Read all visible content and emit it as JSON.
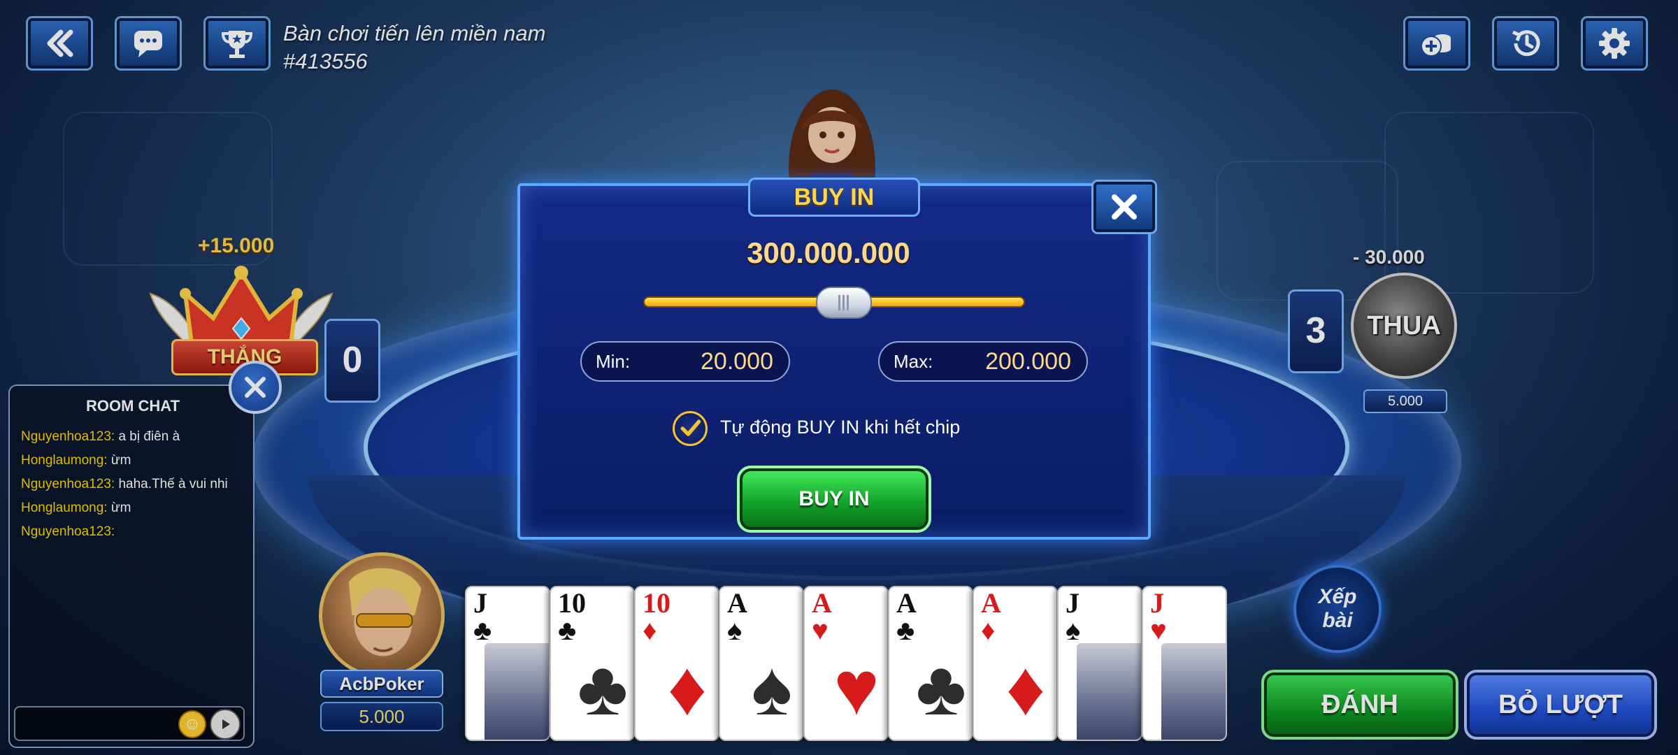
{
  "header": {
    "table_name": "Bàn chơi tiến lên miền nam",
    "table_id": "#413556",
    "left_icons": [
      "back-icon",
      "chat-bubble-icon",
      "trophy-icon"
    ],
    "right_icons": [
      "add-chips-icon",
      "history-icon",
      "gear-icon"
    ]
  },
  "opponent_left": {
    "win_amount": "+15.000",
    "result_label": "THẮNG",
    "cards_left": "0"
  },
  "opponent_right": {
    "lose_amount": "- 30.000",
    "result_label": "THUA",
    "cards_left": "3",
    "chips": "5.000"
  },
  "chat": {
    "title": "ROOM CHAT",
    "messages": [
      {
        "nick": "Nguyenhoa123",
        "text": " a bị điên à"
      },
      {
        "nick": "Honglaumong",
        "text": " ừm"
      },
      {
        "nick": "Nguyenhoa123",
        "text": " haha.Thế à vui nhi"
      },
      {
        "nick": "Honglaumong",
        "text": " ừm"
      },
      {
        "nick": "Nguyenhoa123",
        "text": ""
      }
    ]
  },
  "player": {
    "name": "AcbPoker",
    "chips": "5.000"
  },
  "hand": [
    {
      "rank": "J",
      "suit": "♣",
      "color": "black",
      "face": true
    },
    {
      "rank": "10",
      "suit": "♣",
      "color": "black",
      "face": false
    },
    {
      "rank": "10",
      "suit": "♦",
      "color": "red",
      "face": false
    },
    {
      "rank": "A",
      "suit": "♠",
      "color": "black",
      "face": false
    },
    {
      "rank": "A",
      "suit": "♥",
      "color": "red",
      "face": false
    },
    {
      "rank": "A",
      "suit": "♣",
      "color": "black",
      "face": false
    },
    {
      "rank": "A",
      "suit": "♦",
      "color": "red",
      "face": false
    },
    {
      "rank": "J",
      "suit": "♠",
      "color": "black",
      "face": true
    },
    {
      "rank": "J",
      "suit": "♥",
      "color": "red",
      "face": true
    }
  ],
  "actions": {
    "sort_label": "Xếp bài",
    "play_label": "ĐÁNH",
    "pass_label": "BỎ LƯỢT"
  },
  "buyin_dialog": {
    "title": "BUY IN",
    "amount": "300.000.000",
    "slider_fraction": 0.45,
    "min_label": "Min:",
    "min_value": "20.000",
    "max_label": "Max:",
    "max_value": "200.000",
    "auto_label": "Tự động BUY IN khi hết chip",
    "auto_checked": true,
    "confirm_label": "BUY IN"
  },
  "colors": {
    "gold": "#ffd54a",
    "panel_blue": "#132a86",
    "green_button": "#14a52a",
    "blue_button": "#2252d8"
  }
}
